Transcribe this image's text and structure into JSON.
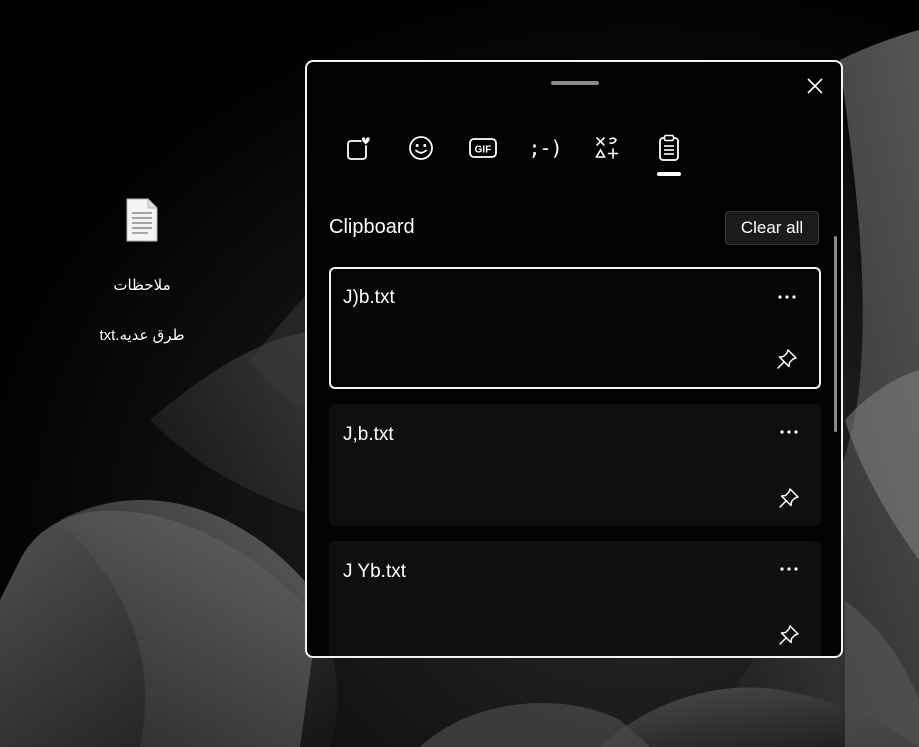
{
  "desktop": {
    "file": {
      "icon": "text-file-icon",
      "name_line1": "ملاحظات",
      "name_line2": "طرق عديه.txt"
    }
  },
  "clipboard_panel": {
    "close_icon": "close-icon",
    "tabs": [
      {
        "id": "favorites",
        "icon": "favorites-heart-icon",
        "selected": false
      },
      {
        "id": "emoji",
        "icon": "emoji-smiley-icon",
        "selected": false
      },
      {
        "id": "gif",
        "icon": "gif-icon",
        "label": "GIF",
        "selected": false
      },
      {
        "id": "kaomoji",
        "icon": "kaomoji-icon",
        "label": ";-)",
        "selected": false
      },
      {
        "id": "symbols",
        "icon": "symbols-icon",
        "selected": false
      },
      {
        "id": "clipboard",
        "icon": "clipboard-icon",
        "selected": true
      }
    ],
    "section_title": "Clipboard",
    "clear_all_label": "Clear all",
    "items": [
      {
        "text": "J)b.txt",
        "selected": true
      },
      {
        "text": "J,b.txt",
        "selected": false
      },
      {
        "text": "J Yb.txt",
        "selected": false
      }
    ],
    "colors": {
      "panel_bg": "#020202",
      "border": "#f2f2f2",
      "item_bg": "#0f0f0f",
      "button_bg": "#1b1b1b"
    }
  }
}
